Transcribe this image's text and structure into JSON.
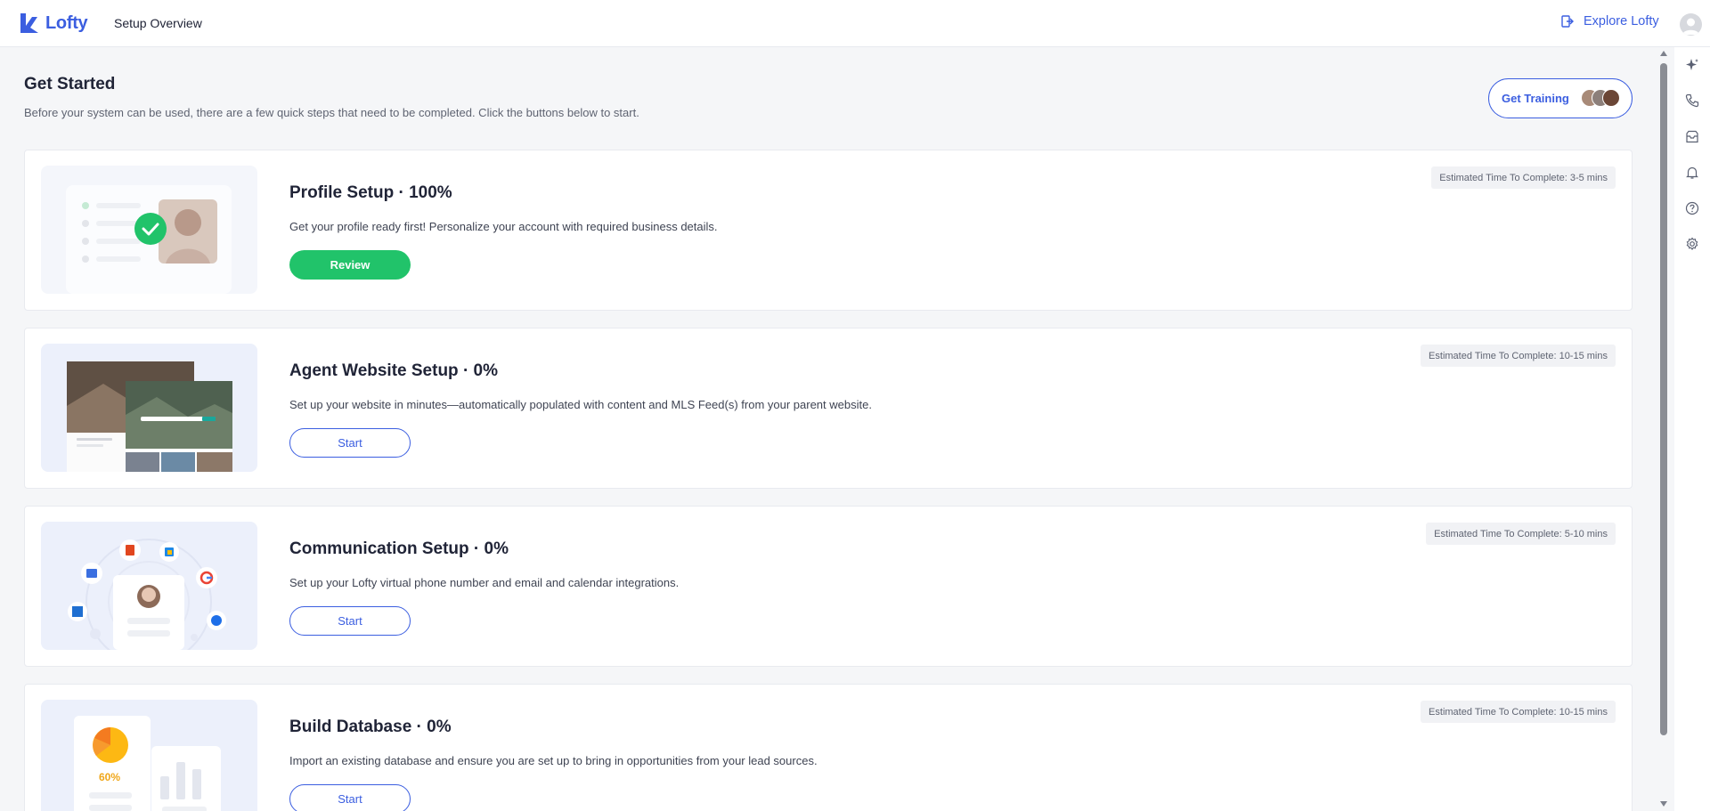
{
  "header": {
    "logo_text": "Lofty",
    "page_title": "Setup Overview",
    "explore_label": "Explore Lofty"
  },
  "rail_icons": [
    "sparkle-icon",
    "phone-icon",
    "inbox-icon",
    "bell-icon",
    "help-icon",
    "gear-icon"
  ],
  "intro": {
    "title": "Get Started",
    "subtitle": "Before your system can be used, there are a few quick steps that need to be completed. Click the buttons below to start.",
    "training_label": "Get Training"
  },
  "cards": [
    {
      "title": "Profile Setup · 100%",
      "progress_percent": 100,
      "description": "Get your profile ready first! Personalize your account with required business details.",
      "button_label": "Review",
      "estimate": "Estimated Time To Complete: 3-5 mins"
    },
    {
      "title": "Agent Website Setup · 0%",
      "progress_percent": 0,
      "description": "Set up your website in minutes—automatically populated with content and MLS Feed(s) from your parent website.",
      "button_label": "Start",
      "estimate": "Estimated Time To Complete: 10-15 mins"
    },
    {
      "title": "Communication Setup · 0%",
      "progress_percent": 0,
      "description": "Set up your Lofty virtual phone number and email and calendar integrations.",
      "button_label": "Start",
      "estimate": "Estimated Time To Complete: 5-10 mins"
    },
    {
      "title": "Build Database · 0%",
      "progress_percent": 0,
      "description": "Import an existing database and ensure you are set up to bring in opportunities from your lead sources.",
      "button_label": "Start",
      "estimate": "Estimated Time To Complete: 10-15 mins",
      "illustration_percent": "60%"
    }
  ],
  "colors": {
    "accent": "#3b5ee0",
    "success": "#21c36a",
    "background": "#f5f6f8"
  }
}
